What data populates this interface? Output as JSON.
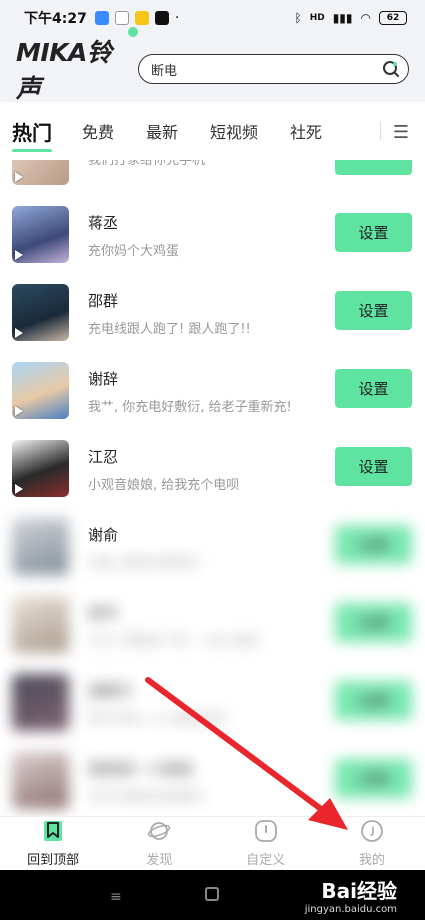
{
  "status_bar": {
    "time": "下午4:27",
    "icons": [
      "bluetooth-app-icon",
      "gmail-icon",
      "weather-icon",
      "tiktok-icon"
    ],
    "dot": "·",
    "network": "HD",
    "battery": "62"
  },
  "header": {
    "logo": "MIKA铃声",
    "search_value": "断电"
  },
  "tabs": [
    {
      "label": "热门",
      "active": true
    },
    {
      "label": "免费",
      "active": false
    },
    {
      "label": "最新",
      "active": false
    },
    {
      "label": "短视频",
      "active": false
    },
    {
      "label": "社死",
      "active": false
    }
  ],
  "list": {
    "partial_top_desc": "我们打家给你充手机",
    "items": [
      {
        "name": "蒋丞",
        "desc": "充你妈个大鸡蛋",
        "button": "设置"
      },
      {
        "name": "邵群",
        "desc": "充电线跟人跑了! 跟人跑了!!",
        "button": "设置"
      },
      {
        "name": "谢辞",
        "desc": "我艹, 你充电好敷衍, 给老子重新充!",
        "button": "设置"
      },
      {
        "name": "江忍",
        "desc": "小观音娘娘, 给我充个电呗",
        "button": "设置"
      },
      {
        "name": "谢俞",
        "desc": "充电, 我的好哥哥们",
        "button": "设置"
      },
      {
        "name": "谢韦",
        "desc": "江沉, 帮我充个电, 一会儿就好",
        "button": "设置"
      },
      {
        "name": "谢聊行",
        "desc": "再不充电, 小心我收拾你",
        "button": "设置"
      },
      {
        "name": "我是我一小姐姐",
        "desc": "可可可爱的充电提示",
        "button": "设置"
      }
    ]
  },
  "bottom_nav": [
    {
      "label": "回到顶部",
      "icon": "bookmark-icon",
      "active": true
    },
    {
      "label": "发现",
      "icon": "planet-icon",
      "active": false
    },
    {
      "label": "自定义",
      "icon": "custom-icon",
      "active": false
    },
    {
      "label": "我的",
      "icon": "profile-icon",
      "active": false
    }
  ],
  "watermark": {
    "brand": "Bai经验",
    "url": "jingyan.baidu.com"
  },
  "colors": {
    "accent": "#5fe3a1",
    "header_bg": "#f1f3f6",
    "arrow": "#e8262c"
  }
}
